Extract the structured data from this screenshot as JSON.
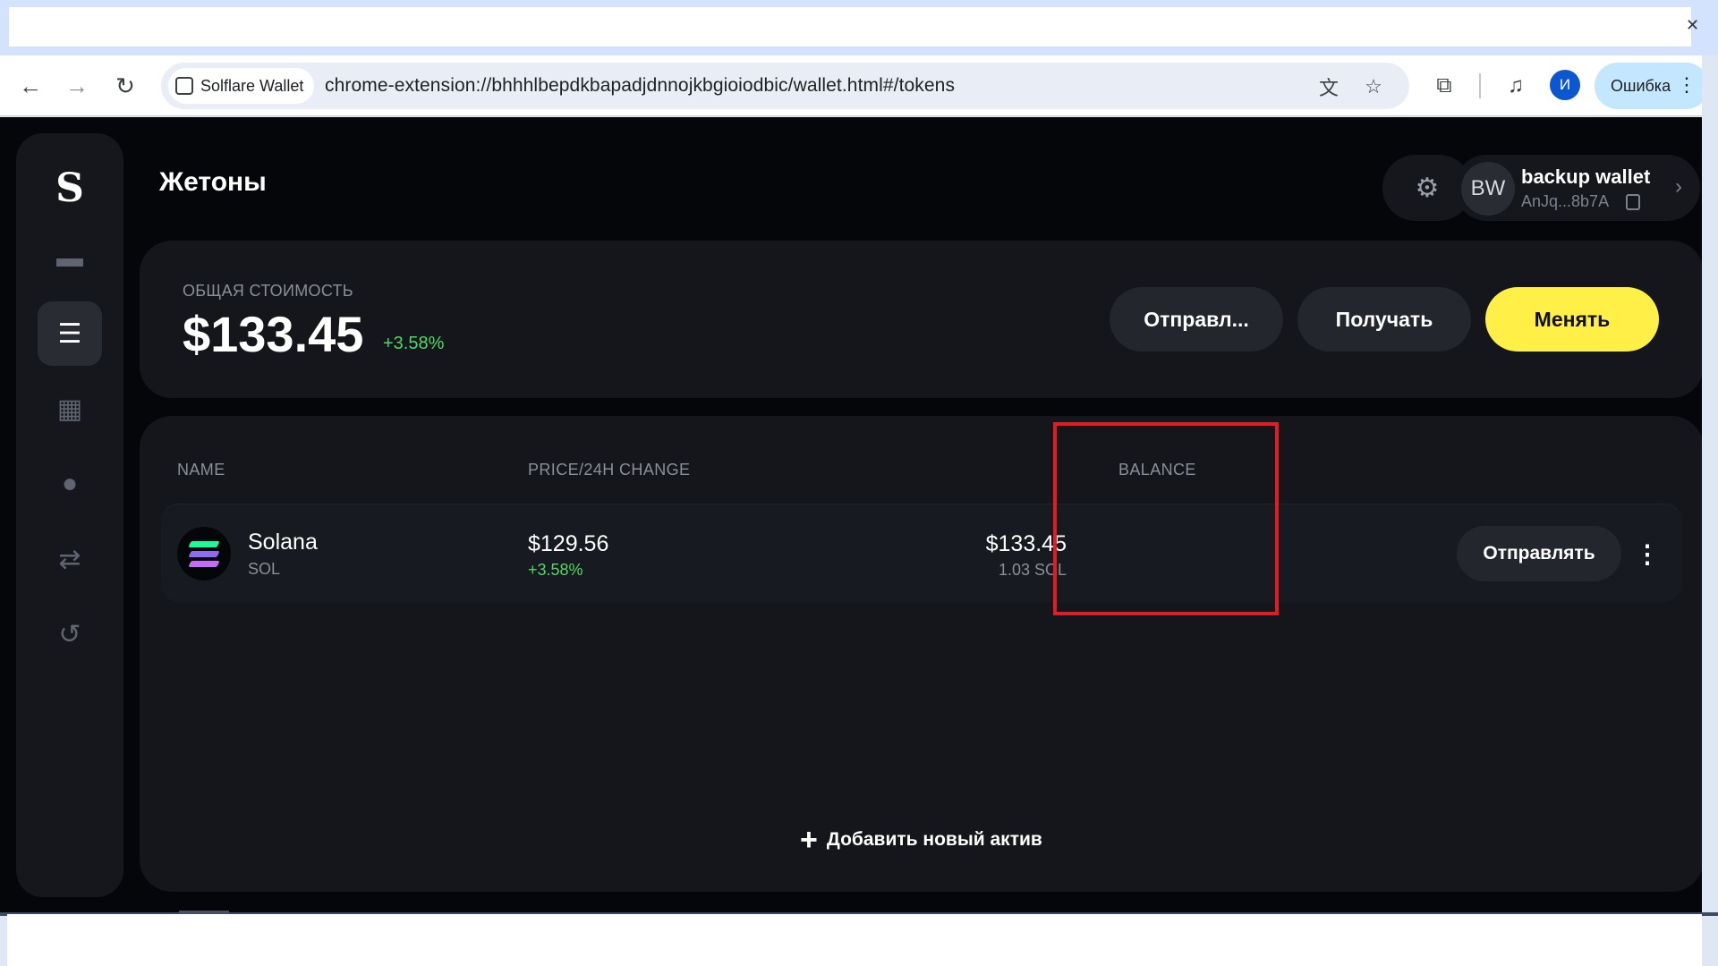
{
  "browser": {
    "site_chip": "Solflare Wallet",
    "url": "chrome-extension://bhhhlbepdkbapadjdnnojkbgioiodbic/wallet.html#/tokens",
    "profile_initial": "И",
    "error_label": "Ошибка"
  },
  "app": {
    "page_title": "Жетоны",
    "account": {
      "avatar": "BW",
      "name": "backup wallet",
      "address": "AnJq...8b7A"
    },
    "summary": {
      "label": "ОБЩАЯ СТОИМОСТЬ",
      "value": "$133.45",
      "change": "+3.58%",
      "send_label": "Отправл...",
      "receive_label": "Получать",
      "swap_label": "Менять"
    },
    "table": {
      "headers": {
        "name": "NAME",
        "price": "PRICE/24H CHANGE",
        "balance": "BALANCE"
      },
      "rows": [
        {
          "name": "Solana",
          "symbol": "SOL",
          "price": "$129.56",
          "change": "+3.58%",
          "balance_usd": "$133.45",
          "balance_amount": "1.03 SOL",
          "send_label": "Отправлять"
        }
      ]
    },
    "add_asset_label": "Добавить новый актив"
  },
  "colors": {
    "background": "#05060a",
    "card": "#14161c",
    "accent_yellow": "#ffef46",
    "positive": "#4cd964",
    "highlight": "#e31b23"
  },
  "icons": {
    "sidebar": [
      "wallet-icon",
      "tokens-icon",
      "collectibles-icon",
      "staking-icon",
      "swap-icon",
      "history-icon"
    ]
  }
}
